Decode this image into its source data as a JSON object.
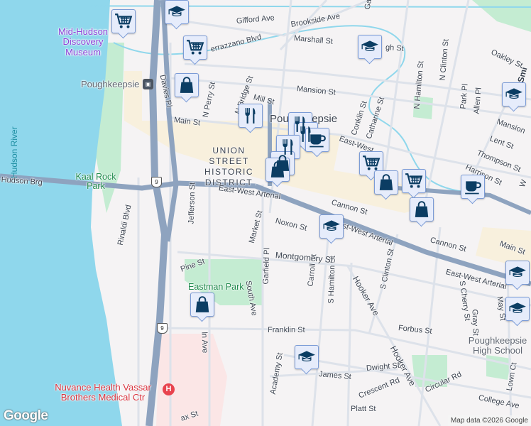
{
  "map": {
    "colors": {
      "water": "#8fd7ec",
      "land": "#f5f3f4",
      "highway": "#8ea3bf",
      "park": "#c4ecd2",
      "commercial": "#f8f0dd",
      "hospital": "#fbe6e6",
      "road": "#dde2ea",
      "marker": "#0b3d63"
    },
    "water_labels": {
      "river": "Hudson River"
    },
    "places": {
      "museum": "Mid-Hudson Discovery Museum",
      "station": "Poughkeepsie",
      "city": "Poughkeepsie",
      "district": "UNION STREET HISTORIC DISTRICT",
      "kaal_rock": "Kaal Rock Park",
      "eastman": "Eastman Park",
      "hospital": "Nuvance Health Vassar Brothers Medical Ctr",
      "high_school": "Poughkeepsie High School"
    },
    "route_shield": "9",
    "streets": {
      "gifford": "Gifford Ave",
      "verrazzano": "errazzano Blvd",
      "brookside": "Brookside Ave",
      "marshall": "Marshall St",
      "high": "gh St",
      "oakley": "Oakley St",
      "smith": "Smi",
      "mansion": "Mansion St",
      "mansion2": "Mansion",
      "mill": "Mill St",
      "davies": "Davies Pl",
      "nperry": "N Perry St",
      "nbridge": "N Bridge St",
      "main": "Main St",
      "main2": "Main St",
      "conklin": "Conklin St",
      "catharine": "Catharine St",
      "nhamilton": "N Hamilton St",
      "nclinton": "N Clinton St",
      "park": "Park Pl",
      "allen": "Allen Pl",
      "lent": "Lent St",
      "thompson": "Thompson St",
      "harrison": "Harrison St",
      "bridge": "-Hudson Brg",
      "ew1": "East-West Arterial",
      "ew2": "East-West Arterial",
      "ew3": "East-West Arterial",
      "ew_top": "East-West",
      "cannon": "Cannon St",
      "cannon2": "Cannon St",
      "noxon": "Noxon St",
      "market": "Market St",
      "jefferson": "Jefferson St",
      "rinaldi": "Rinaldi Blvd",
      "pine": "Pine St",
      "south": "South Ave",
      "garfield": "Garfield Pl",
      "carroll": "Carroll St",
      "shamilton": "S Hamilton St",
      "hooker": "Hooker Ave",
      "hooker2": "Hooker Ave",
      "sclinton": "S Clinton St",
      "montgomery": "Montgomery St",
      "franklin": "Franklin St",
      "forbus": "Forbus St",
      "scherry": "S Cherry St",
      "gray": "Gray St",
      "may": "May St",
      "dwight": "Dwight St",
      "james": "James St",
      "crescent": "Crescent Rd",
      "circular": "Circular Rd",
      "college": "College Ave",
      "platt": "Platt St",
      "academy": "Academy St",
      "lown": "Lown Ct",
      "lincoln": "ln Ave",
      "fox": "ax St",
      "garden": "Gard",
      "w": "W"
    },
    "markers": [
      {
        "type": "cart"
      },
      {
        "type": "school"
      },
      {
        "type": "cart"
      },
      {
        "type": "bag"
      },
      {
        "type": "restaurant"
      },
      {
        "type": "school"
      },
      {
        "type": "school"
      },
      {
        "type": "restaurant"
      },
      {
        "type": "restaurant"
      },
      {
        "type": "cafe"
      },
      {
        "type": "restaurant"
      },
      {
        "type": "bag"
      },
      {
        "type": "bag"
      },
      {
        "type": "cart"
      },
      {
        "type": "bag"
      },
      {
        "type": "cart"
      },
      {
        "type": "cafe"
      },
      {
        "type": "bag"
      },
      {
        "type": "school"
      },
      {
        "type": "school"
      },
      {
        "type": "school"
      },
      {
        "type": "bag"
      },
      {
        "type": "school"
      }
    ],
    "logo": "Google",
    "attribution": "Map data ©2026 Google"
  }
}
